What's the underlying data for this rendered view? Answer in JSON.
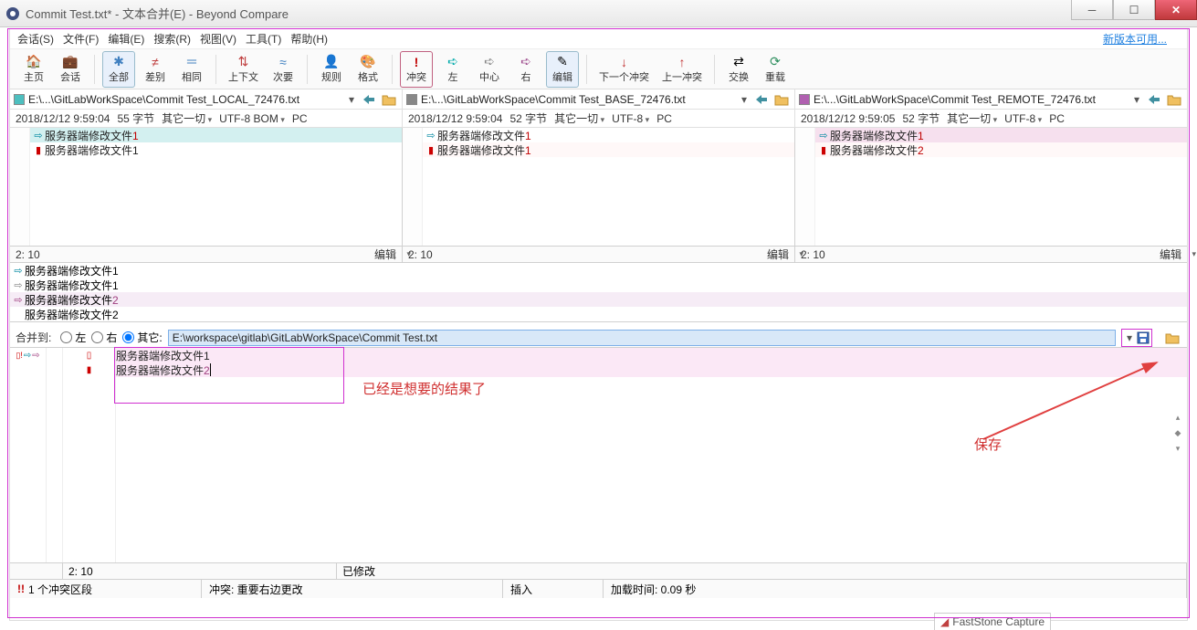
{
  "window": {
    "title": "Commit Test.txt* - 文本合并(E) - Beyond Compare"
  },
  "menu": {
    "items": [
      "会话(S)",
      "文件(F)",
      "编辑(E)",
      "搜索(R)",
      "视图(V)",
      "工具(T)",
      "帮助(H)"
    ],
    "new_version": "新版本可用..."
  },
  "toolbar": {
    "home": "主页",
    "session": "会话",
    "all": "全部",
    "diff": "差别",
    "same": "相同",
    "context": "上下文",
    "minor": "次要",
    "rules": "规则",
    "format": "格式",
    "conflict": "冲突",
    "left": "左",
    "center": "中心",
    "right": "右",
    "edit": "编辑",
    "next_conflict": "下一个冲突",
    "prev_conflict": "上一冲突",
    "swap": "交换",
    "reload": "重载"
  },
  "paths": {
    "left": "E:\\...\\GitLabWorkSpace\\Commit Test_LOCAL_72476.txt",
    "center": "E:\\...\\GitLabWorkSpace\\Commit Test_BASE_72476.txt",
    "right": "E:\\...\\GitLabWorkSpace\\Commit Test_REMOTE_72476.txt"
  },
  "info": {
    "left": {
      "date": "2018/12/12 9:59:04",
      "size": "55 字节",
      "other": "其它一切",
      "enc": "UTF-8 BOM",
      "eol": "PC"
    },
    "center": {
      "date": "2018/12/12 9:59:04",
      "size": "52 字节",
      "other": "其它一切",
      "enc": "UTF-8",
      "eol": "PC"
    },
    "right": {
      "date": "2018/12/12 9:59:05",
      "size": "52 字节",
      "other": "其它一切",
      "enc": "UTF-8",
      "eol": "PC"
    }
  },
  "content": {
    "left": {
      "line1": "服务器端修改文件",
      "line1n": "1",
      "line2": "服务器端修改文件1"
    },
    "center": {
      "line1": "服务器端修改文件",
      "line1n": "1",
      "line2": "服务器端修改文件",
      "line2n": "1"
    },
    "right": {
      "line1": "服务器端修改文件",
      "line1n": "1",
      "line2": "服务器端修改文件",
      "line2n": "2"
    }
  },
  "cursor": {
    "left": "2: 10",
    "center": "2: 10",
    "right": "2: 10",
    "edit_label": "编辑"
  },
  "merge_lines": {
    "l1": "服务器端修改文件1",
    "l2": "服务器端修改文件",
    "l2n": "1",
    "l3": "服务器端修改文件",
    "l3n": "2",
    "l4": "服务器端修改文件2"
  },
  "merge_to": {
    "label": "合并到:",
    "opt_left": "左",
    "opt_right": "右",
    "opt_other": "其它:",
    "path": "E:\\workspace\\gitlab\\GitLabWorkSpace\\Commit Test.txt"
  },
  "output": {
    "line1": "服务器端修改文件1",
    "line2": "服务器端修改文件",
    "line2n": "2",
    "cursor": "2: 10",
    "status": "已修改"
  },
  "status": {
    "conflict": "1 个冲突区段",
    "conflict_detail": "冲突: 重要右边更改",
    "mode": "插入",
    "load_time": "加载时间: 0.09 秒"
  },
  "annotations": {
    "result": "已经是想要的结果了",
    "save": "保存"
  },
  "footer_extra": "FastStone Capture"
}
